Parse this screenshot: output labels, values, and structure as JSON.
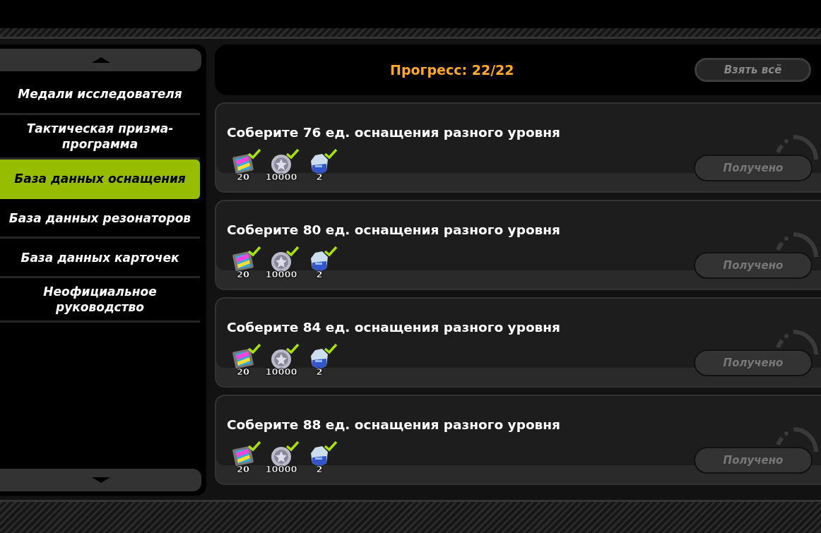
{
  "sidebar": {
    "items": [
      {
        "label": "Медали исследователя",
        "selected": false
      },
      {
        "label": "Тактическая призма-программа",
        "selected": false
      },
      {
        "label": "База данных оснащения",
        "selected": true
      },
      {
        "label": "База данных резонаторов",
        "selected": false
      },
      {
        "label": "База данных карточек",
        "selected": false
      },
      {
        "label": "Неофициальное руководство",
        "selected": false
      }
    ]
  },
  "header": {
    "progress": "Прогресс: 22/22",
    "claim_all": "Взять всё"
  },
  "missions": [
    {
      "title": "Соберите 76 ед. оснащения разного уровня",
      "claimed": true,
      "button": "Получено",
      "rewards": [
        {
          "kind": "film",
          "amount": "20",
          "collected": true
        },
        {
          "kind": "coin",
          "amount": "10000",
          "collected": true
        },
        {
          "kind": "crystal",
          "amount": "2",
          "collected": true
        }
      ]
    },
    {
      "title": "Соберите 80 ед. оснащения разного уровня",
      "claimed": true,
      "button": "Получено",
      "rewards": [
        {
          "kind": "film",
          "amount": "20",
          "collected": true
        },
        {
          "kind": "coin",
          "amount": "10000",
          "collected": true
        },
        {
          "kind": "crystal",
          "amount": "2",
          "collected": true
        }
      ]
    },
    {
      "title": "Соберите 84 ед. оснащения разного уровня",
      "claimed": true,
      "button": "Получено",
      "rewards": [
        {
          "kind": "film",
          "amount": "20",
          "collected": true
        },
        {
          "kind": "coin",
          "amount": "10000",
          "collected": true
        },
        {
          "kind": "crystal",
          "amount": "2",
          "collected": true
        }
      ]
    },
    {
      "title": "Соберите 88 ед. оснащения разного уровня",
      "claimed": true,
      "button": "Получено",
      "rewards": [
        {
          "kind": "film",
          "amount": "20",
          "collected": true
        },
        {
          "kind": "coin",
          "amount": "10000",
          "collected": true
        },
        {
          "kind": "crystal",
          "amount": "2",
          "collected": true
        }
      ]
    }
  ]
}
